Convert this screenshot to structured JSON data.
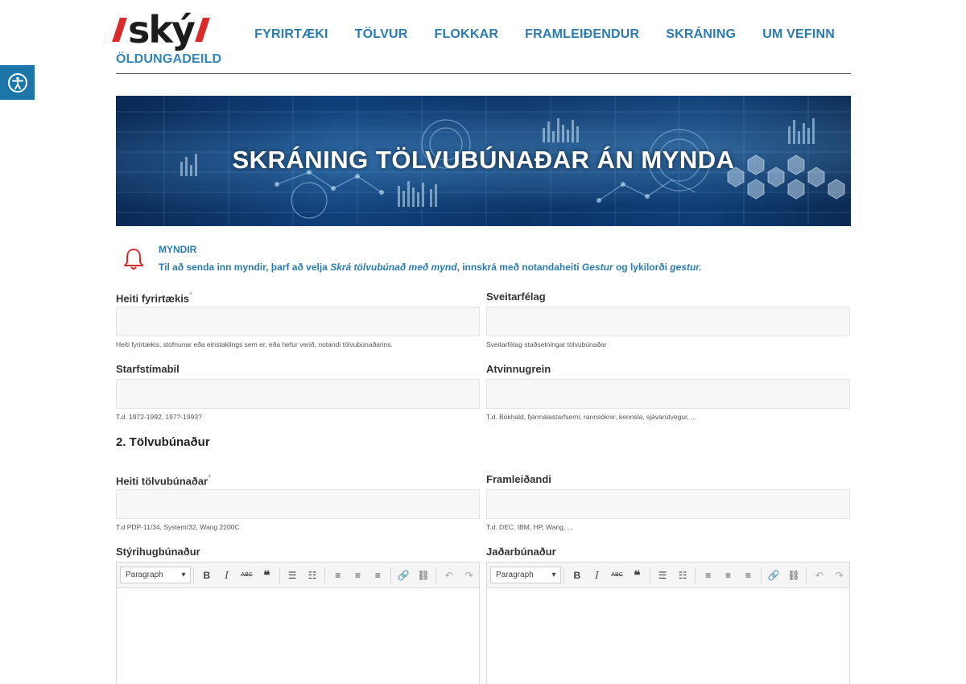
{
  "header": {
    "logo_word": "ský",
    "logo_sub": "ÖLDUNGADEILD",
    "nav": [
      "FYRIRTÆKI",
      "TÖLVUR",
      "FLOKKAR",
      "FRAMLEIÐENDUR",
      "SKRÁNING",
      "UM VEFINN"
    ]
  },
  "banner": {
    "title": "SKRÁNING TÖLVUBÚNAÐAR ÁN MYNDA"
  },
  "notice": {
    "title": "MYNDIR",
    "text_1": "Til að senda inn myndir, þarf að velja ",
    "em_1": "Skrá tölvubúnað með mynd",
    "text_2": ", innskrá með notandaheiti ",
    "em_2": "Gestur",
    "text_3": " og lykilorði ",
    "em_3": "gestur."
  },
  "form": {
    "company": {
      "label": "Heiti fyrirtækis",
      "required": "*",
      "help": "Heiti fyrirtækis, stofnunar eða einstaklings sem er, eða hefur verið, notandi tölvubúnaðarins."
    },
    "municipality": {
      "label": "Sveitarfélag",
      "help": "Sveitarfélag staðsetningar tölvubúnaðar"
    },
    "period": {
      "label": "Starfstímabil",
      "help": "T.d. 1972-1992, 197?-1993?"
    },
    "industry": {
      "label": "Atvinnugrein",
      "help": "T.d. Bókhald, fjármálastarfsemi, rannsóknir, kennsla, sjávarútvegur, ..."
    },
    "section_2": "2. Tölvubúnaður",
    "equipment": {
      "label": "Heiti tölvubúnaðar",
      "required": "*",
      "help": "T.d PDP-11/34, System/32, Wang 2200C"
    },
    "manufacturer": {
      "label": "Framleiðandi",
      "help": "T.d. DEC, IBM, HP, Wang, ..."
    },
    "os": {
      "label": "Stýrihugbúnaður"
    },
    "peripherals": {
      "label": "Jaðarbúnaður"
    },
    "editor_format": "Paragraph"
  },
  "icons": {
    "accessibility": "accessibility-icon",
    "bell": "bell-icon"
  },
  "colors": {
    "brand_blue": "#2b7bb0",
    "logo_red": "#d92b2b",
    "access_bg": "#1c77a8"
  }
}
